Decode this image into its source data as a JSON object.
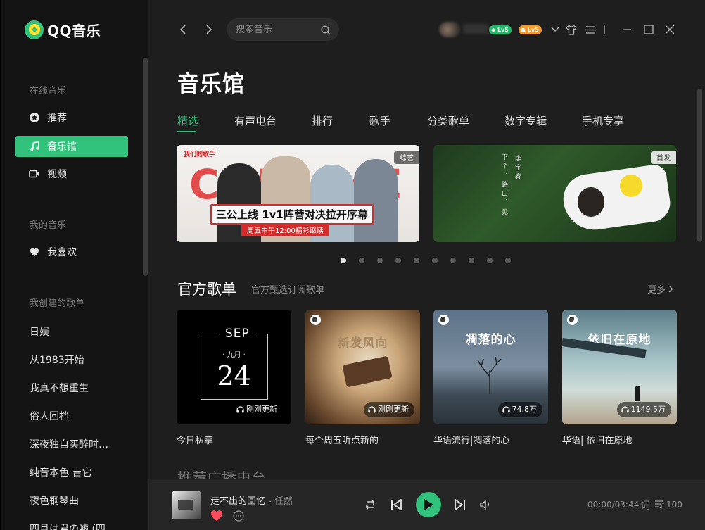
{
  "app": {
    "name": "QQ音乐"
  },
  "sidebar": {
    "sections": {
      "online": "在线音乐",
      "mine": "我的音乐",
      "created": "我创建的歌单"
    },
    "online_items": [
      {
        "label": "推荐",
        "icon": "star-icon"
      },
      {
        "label": "音乐馆",
        "icon": "music-note-icon",
        "active": true
      },
      {
        "label": "视频",
        "icon": "video-icon"
      }
    ],
    "mine_items": [
      {
        "label": "我喜欢",
        "icon": "heart-icon"
      }
    ],
    "playlists": [
      "日娱",
      "从1983开始",
      "我真不想重生",
      "俗人回档",
      "深夜独自买醉时听…",
      "纯音本色 吉它",
      "夜色钢琴曲",
      "四月は君の嘘 (四"
    ]
  },
  "topbar": {
    "search_placeholder": "搜索音乐",
    "badges": [
      "Lv5",
      "Lv5"
    ]
  },
  "page": {
    "title": "音乐馆",
    "tabs": [
      "精选",
      "有声电台",
      "排行",
      "歌手",
      "分类歌单",
      "数字专辑",
      "手机专享"
    ],
    "active_tab": 0
  },
  "banners": [
    {
      "tag": "综艺",
      "big_text": "CALL ME",
      "headline": "三公上线 1v1阵营对决拉开序幕",
      "subline": "周五中午12:00精彩继续",
      "logo": "我们的歌手"
    },
    {
      "tag": "首发",
      "vertical_text_1": "下个，路口，见",
      "vertical_text_2": "李宇春"
    }
  ],
  "carousel": {
    "count": 10,
    "active": 0
  },
  "official_playlists": {
    "title": "官方歌单",
    "subtitle": "官方甄选订阅歌单",
    "more": "更多",
    "cards": [
      {
        "name": "今日私享",
        "badge": "刚刚更新",
        "month": "SEP",
        "month_cn": "· 九月 ·",
        "day": "24"
      },
      {
        "name": "每个周五听点新的",
        "badge": "刚刚更新",
        "overlay_title": "新发风向"
      },
      {
        "name": "华语流行|凋落的心",
        "badge": "74.8万",
        "overlay_title": "凋落的心"
      },
      {
        "name": "华语| 依旧在原地",
        "badge": "1149.5万",
        "overlay_title": "依旧在原地"
      }
    ]
  },
  "next_section_peek": "推荐广播电台",
  "player": {
    "song": "走不出的回忆",
    "separator": " - ",
    "artist": "任然",
    "time_current": "00:00",
    "time_total": "03:44",
    "lyric": "词",
    "queue_count": "100"
  },
  "colors": {
    "accent": "#31c27c",
    "sidebar_bg": "#141414",
    "main_bg": "#1e1e1e",
    "player_bg": "#262626",
    "like": "#ff4d5e"
  }
}
